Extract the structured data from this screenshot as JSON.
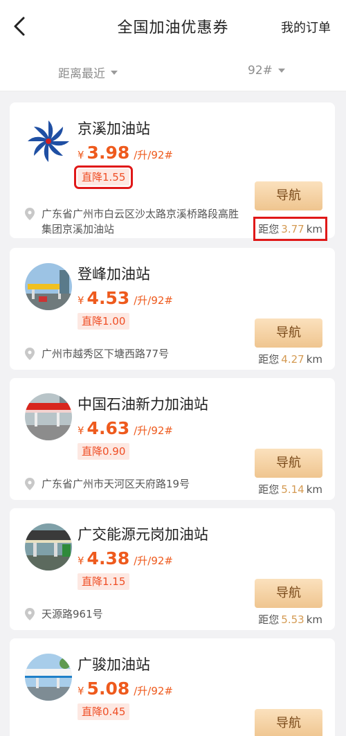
{
  "header": {
    "title": "全国加油优惠券",
    "orders_label": "我的订单",
    "back_icon": "chevron-left-icon"
  },
  "filters": {
    "sort_label": "距离最近",
    "fuel_label": "92#"
  },
  "stations": [
    {
      "name": "京溪加油站",
      "currency": "¥",
      "price": "3.98",
      "unit": "/升/92#",
      "discount": "直降1.55",
      "nav_label": "导航",
      "address": "广东省广州市白云区沙太路京溪桥路段高胜集团京溪加油站",
      "distance_prefix": "距您",
      "distance_value": "3.77",
      "distance_unit": "km"
    },
    {
      "name": "登峰加油站",
      "currency": "¥",
      "price": "4.53",
      "unit": "/升/92#",
      "discount": "直降1.00",
      "nav_label": "导航",
      "address": "广州市越秀区下塘西路77号",
      "distance_prefix": "距您",
      "distance_value": "4.27",
      "distance_unit": "km"
    },
    {
      "name": "中国石油新力加油站",
      "currency": "¥",
      "price": "4.63",
      "unit": "/升/92#",
      "discount": "直降0.90",
      "nav_label": "导航",
      "address": "广东省广州市天河区天府路19号",
      "distance_prefix": "距您",
      "distance_value": "5.14",
      "distance_unit": "km"
    },
    {
      "name": "广交能源元岗加油站",
      "currency": "¥",
      "price": "4.38",
      "unit": "/升/92#",
      "discount": "直降1.15",
      "nav_label": "导航",
      "address": "天源路961号",
      "distance_prefix": "距您",
      "distance_value": "5.53",
      "distance_unit": "km"
    },
    {
      "name": "广骏加油站",
      "currency": "¥",
      "price": "5.08",
      "unit": "/升/92#",
      "discount": "直降0.45",
      "nav_label": "导航"
    }
  ]
}
